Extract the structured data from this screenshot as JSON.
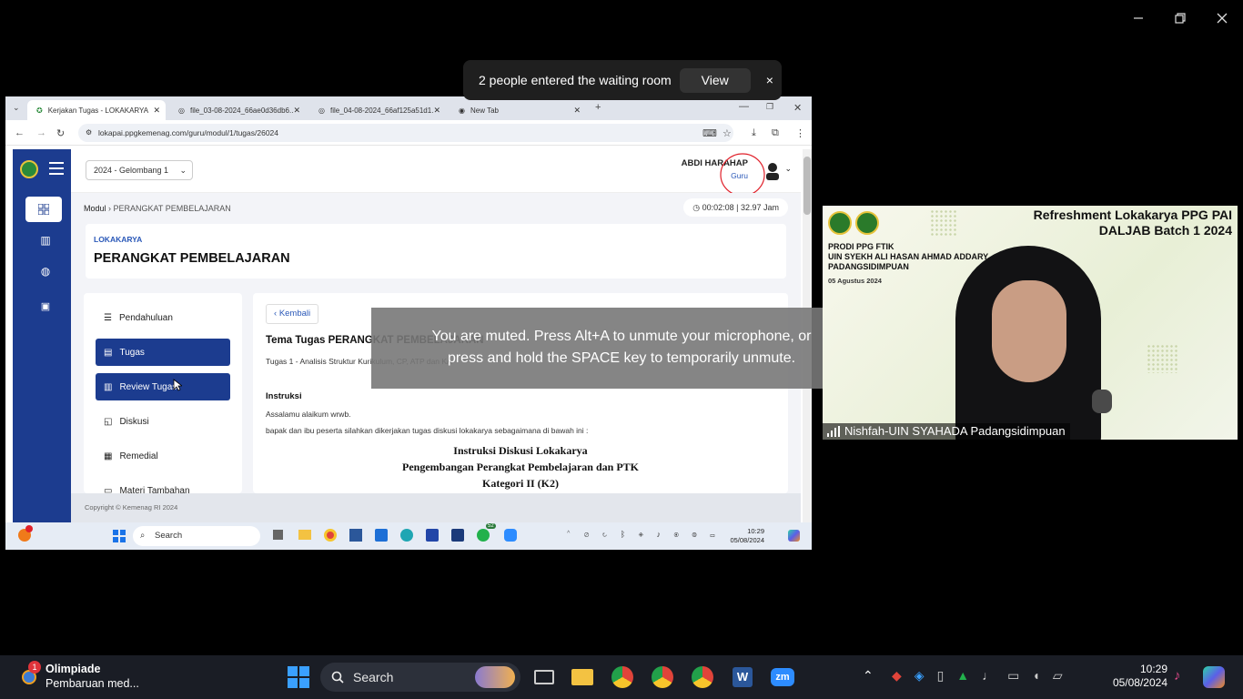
{
  "notification": {
    "text": "2 people entered the waiting room",
    "view_label": "View",
    "close": "×"
  },
  "browser": {
    "tabs": [
      {
        "label": "Kerjakan Tugas - LOKAKARYA"
      },
      {
        "label": "file_03-08-2024_66ae0d36db6..."
      },
      {
        "label": "file_04-08-2024_66af125a51d1..."
      },
      {
        "label": "New Tab"
      }
    ],
    "url": "lokapai.ppgkemenag.com/guru/modul/1/tugas/26024"
  },
  "page": {
    "period_select": "2024 - Gelombang 1",
    "user_name": "ABDI HARAHAP",
    "user_role": "Guru",
    "breadcrumb_root": "Modul",
    "breadcrumb_current": "PERANGKAT PEMBELAJARAN",
    "timer": "00:02:08 | 32.97 Jam",
    "section_label": "LOKAKARYA",
    "title": "PERANGKAT PEMBELAJARAN",
    "menu": [
      {
        "label": "Pendahuluan"
      },
      {
        "label": "Tugas"
      },
      {
        "label": "Review Tugas"
      },
      {
        "label": "Diskusi"
      },
      {
        "label": "Remedial"
      },
      {
        "label": "Materi Tambahan"
      }
    ],
    "back_label": "Kembali",
    "task_title": "Tema Tugas PERANGKAT PEMBELAJARAN",
    "task_sub": "Tugas 1 - Analisis Struktur Kurikulum, CP, ATP dan KA",
    "instr_heading": "Instruksi",
    "instr_line1": "Assalamu alaikum wrwb.",
    "instr_line2": "bapak dan ibu peserta silahkan dikerjakan tugas diskusi lokakarya sebagaimana di bawah ini :",
    "doc_line1": "Instruksi Diskusi Lokakarya",
    "doc_line2": "Pengembangan Perangkat Pembelajaran dan PTK",
    "doc_line3": "Kategori II (K2)",
    "footer": "Copyright © Kemenag RI 2024"
  },
  "remote_taskbar": {
    "search": "Search",
    "time": "10:29",
    "date": "05/08/2024",
    "whatsapp_badge": "52"
  },
  "muted_toast": {
    "line1": "You are muted. Press Alt+A to unmute your microphone, or",
    "line2": "press and hold the SPACE key to temporarily unmute."
  },
  "video": {
    "banner_title_1": "Refreshment Lokakarya PPG PAI",
    "banner_title_2": "DALJAB Batch 1 2024",
    "banner_sub_1": "PRODI PPG FTIK",
    "banner_sub_2": "UIN SYEKH ALI HASAN AHMAD ADDARY",
    "banner_sub_3": "PADANGSIDIMPUAN",
    "banner_date": "05 Agustus 2024",
    "participant": "Nishfah-UIN SYAHADA Padangsidimpuan"
  },
  "taskbar": {
    "news_badge": "1",
    "news_title": "Olimpiade",
    "news_sub": "Pembaruan med...",
    "search": "Search",
    "time": "10:29",
    "date": "05/08/2024"
  },
  "colors": {
    "brand_blue": "#1c3c8f",
    "accent_blue": "#2a58b8",
    "annotation_red": "#e0202a"
  }
}
